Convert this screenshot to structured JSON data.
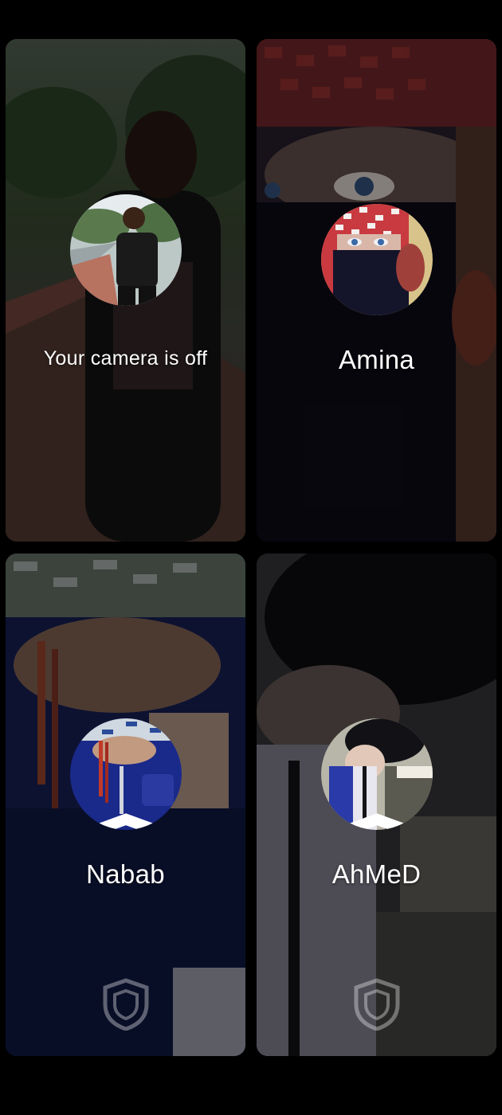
{
  "participants": [
    {
      "id": "self",
      "label": "Your camera is off",
      "avatar_icon": "user-avatar-self",
      "tile_color": "#3e4a3a",
      "shield": false
    },
    {
      "id": "amina",
      "label": "Amina",
      "avatar_icon": "user-avatar-amina",
      "tile_color": "#1a1822",
      "shield": false
    },
    {
      "id": "nabab",
      "label": "Nabab",
      "avatar_icon": "user-avatar-nabab",
      "tile_color": "#16204a",
      "shield": true
    },
    {
      "id": "ahmed",
      "label": "AhMeD",
      "avatar_icon": "user-avatar-ahmed",
      "tile_color": "#2c2c34",
      "shield": true
    }
  ],
  "icons": {
    "shield": "shield-icon"
  }
}
